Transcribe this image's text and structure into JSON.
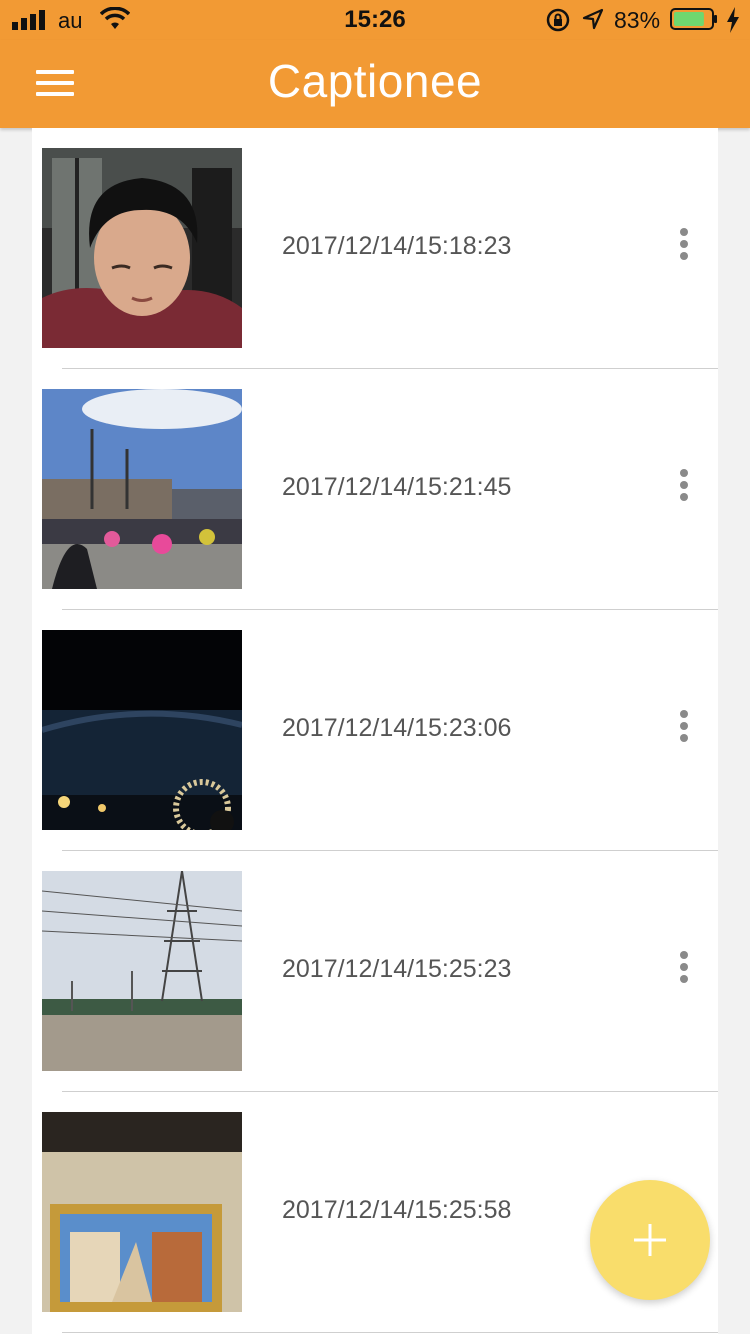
{
  "status_bar": {
    "carrier": "au",
    "time": "15:26",
    "battery_percent": "83%",
    "battery_level": 0.83
  },
  "header": {
    "title": "Captionee",
    "menu_icon": "hamburger-menu-icon"
  },
  "items": [
    {
      "timestamp": "2017/12/14/15:18:23",
      "thumbnail": "portrait-photo"
    },
    {
      "timestamp": "2017/12/14/15:21:45",
      "thumbnail": "parade-photo"
    },
    {
      "timestamp": "2017/12/14/15:23:06",
      "thumbnail": "night-fireworks-photo"
    },
    {
      "timestamp": "2017/12/14/15:25:23",
      "thumbnail": "power-tower-field-photo"
    },
    {
      "timestamp": "2017/12/14/15:25:58",
      "thumbnail": "framed-painting-photo"
    }
  ],
  "fab": {
    "icon": "plus-icon"
  },
  "colors": {
    "accent": "#f29a34",
    "fab": "#f9dd6b",
    "battery": "#6fd76f"
  }
}
